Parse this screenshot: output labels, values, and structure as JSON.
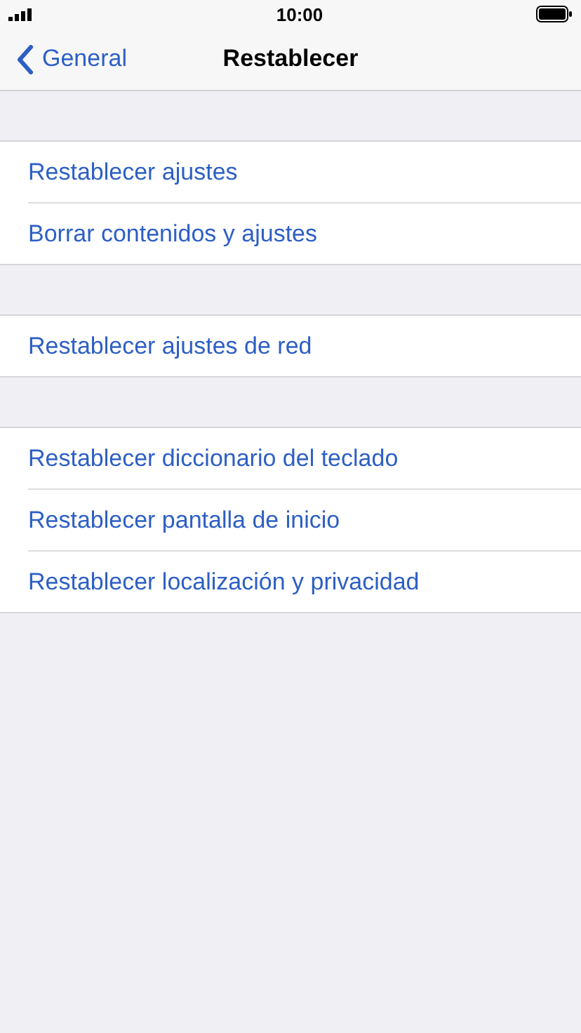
{
  "status_bar": {
    "time": "10:00"
  },
  "nav_bar": {
    "back": "General",
    "title": "Restablecer"
  },
  "groups": [
    {
      "items": [
        "Restablecer ajustes",
        "Borrar contenidos y ajustes"
      ]
    },
    {
      "items": [
        "Restablecer ajustes de red"
      ]
    },
    {
      "items": [
        "Restablecer diccionario del teclado",
        "Restablecer pantalla de inicio",
        "Restablecer localización y privacidad"
      ]
    }
  ]
}
